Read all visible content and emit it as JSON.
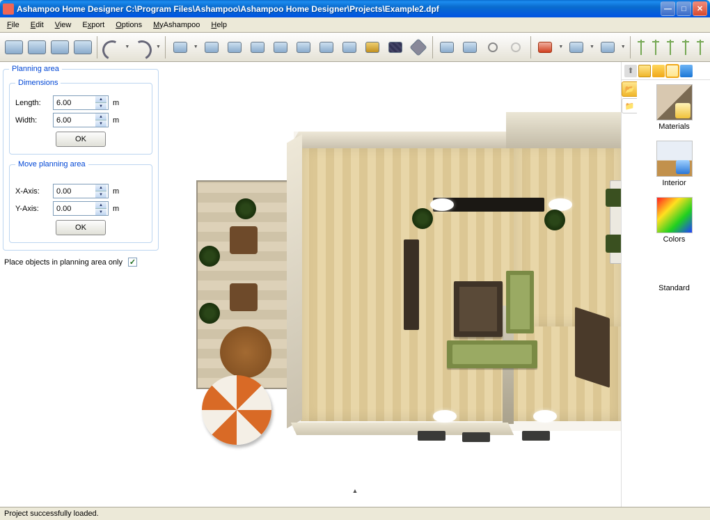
{
  "title": "Ashampoo Home Designer C:\\Program Files\\Ashampoo\\Ashampoo Home Designer\\Projects\\Example2.dpf",
  "menu": [
    "File",
    "Edit",
    "View",
    "Export",
    "Options",
    "MyAshampoo",
    "Help"
  ],
  "panel": {
    "planning_area_title": "Planning area",
    "dimensions_title": "Dimensions",
    "length_label": "Length:",
    "length_value": "6.00",
    "width_label": "Width:",
    "width_value": "6.00",
    "unit": "m",
    "ok_label": "OK",
    "move_title": "Move planning area",
    "x_label": "X-Axis:",
    "x_value": "0.00",
    "y_label": "Y-Axis:",
    "y_value": "0.00",
    "checkbox_label": "Place objects in planning area only",
    "checkbox_checked": true
  },
  "right": {
    "items": {
      "materials": "Materials",
      "interior": "Interior",
      "colors": "Colors",
      "standard": "Standard"
    }
  },
  "status": "Project successfully loaded.",
  "toolbar_icons": [
    "view-3d-1",
    "view-3d-2",
    "view-3d-3",
    "view-3d-4",
    "undo",
    "redo",
    "shape-1",
    "shape-2",
    "shape-3",
    "shape-4",
    "shape-5",
    "shape-6",
    "shape-7",
    "shape-8",
    "shape-9",
    "shape-roof",
    "shape-flat",
    "nav-1",
    "nav-2",
    "zoom-in",
    "zoom-out",
    "home-red",
    "level",
    "group",
    "pole-1",
    "pole-2",
    "pole-3",
    "pole-4",
    "pole-5"
  ]
}
